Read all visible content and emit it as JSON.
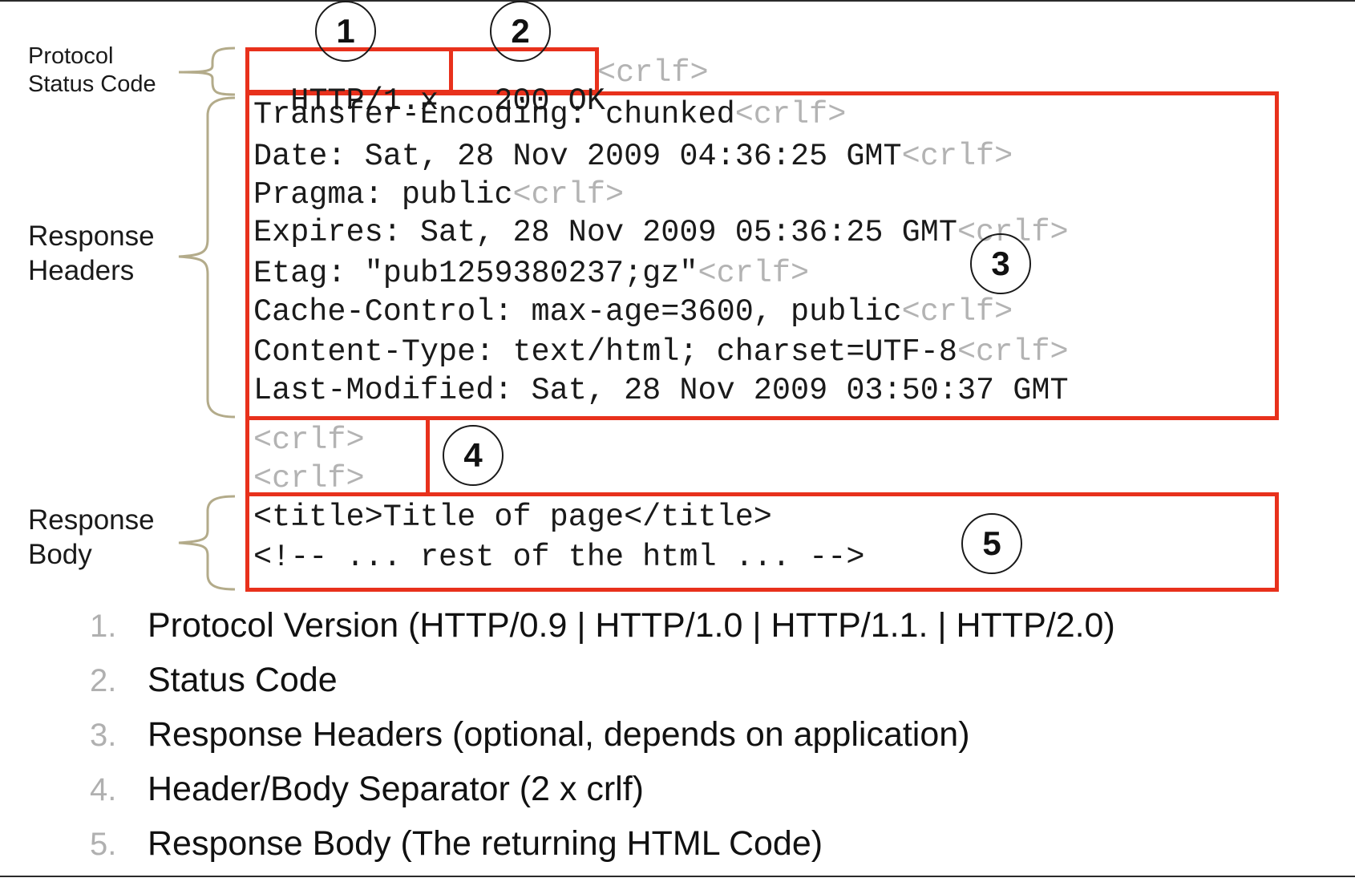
{
  "side_labels": {
    "protocol_status": [
      "Protocol",
      "Status Code"
    ],
    "response_headers": [
      "Response",
      "Headers"
    ],
    "response_body": [
      "Response",
      "Body"
    ]
  },
  "status_line": {
    "protocol": "HTTP/1.x",
    "status": "200 OK",
    "crlf": "<crlf>"
  },
  "headers": [
    {
      "text": "Transfer-Encoding: chunked",
      "crlf": "<crlf>"
    },
    {
      "text": "Date: Sat, 28 Nov 2009 04:36:25 GMT",
      "crlf": "<crlf>"
    },
    {
      "text": "Pragma: public",
      "crlf": "<crlf>"
    },
    {
      "text": "Expires: Sat, 28 Nov 2009 05:36:25 GMT",
      "crlf": "<crlf>"
    },
    {
      "text": "Etag: \"pub1259380237;gz\"",
      "crlf": "<crlf>"
    },
    {
      "text": "Cache-Control: max-age=3600, public",
      "crlf": "<crlf>"
    },
    {
      "text": "Content-Type: text/html; charset=UTF-8",
      "crlf": "<crlf>"
    },
    {
      "text": "Last-Modified: Sat, 28 Nov 2009 03:50:37 GMT",
      "crlf": ""
    }
  ],
  "separator": [
    "<crlf>",
    "<crlf>"
  ],
  "body": [
    "<title>Title of page</title>",
    "<!-- ... rest of the html ... -->"
  ],
  "markers": [
    "1",
    "2",
    "3",
    "4",
    "5"
  ],
  "legend": [
    {
      "num": "1.",
      "text": "Protocol Version (HTTP/0.9 | HTTP/1.0 | HTTP/1.1. | HTTP/2.0)"
    },
    {
      "num": "2.",
      "text": "Status Code"
    },
    {
      "num": "3.",
      "text": "Response Headers (optional, depends on application)"
    },
    {
      "num": "4.",
      "text": "Header/Body Separator (2 x crlf)"
    },
    {
      "num": "5.",
      "text": "Response Body (The returning HTML Code)"
    }
  ],
  "colors": {
    "box": "#e8311c",
    "brace": "#b3ab8a",
    "crlf": "#b3b3b3",
    "legend_number": "#b0b0b0"
  }
}
